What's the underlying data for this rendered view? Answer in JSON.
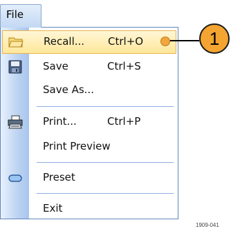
{
  "menubar": {
    "file_label": "File"
  },
  "menu": {
    "items": [
      {
        "label": "Recall...",
        "shortcut": "Ctrl+O",
        "icon": "folder-icon",
        "selected": true
      },
      {
        "label": "Save",
        "shortcut": "Ctrl+S",
        "icon": "floppy-disk-icon"
      },
      {
        "label": "Save As...",
        "shortcut": ""
      },
      {
        "label": "Print...",
        "shortcut": "Ctrl+P",
        "icon": "printer-icon"
      },
      {
        "label": "Print Preview",
        "shortcut": ""
      },
      {
        "label": "Preset",
        "shortcut": "",
        "icon": "preset-icon"
      },
      {
        "label": "Exit",
        "shortcut": ""
      }
    ]
  },
  "callout": {
    "number": "1",
    "color": "#f4a431"
  },
  "figure_id": "1909-041",
  "colors": {
    "highlight": "#ffe79a",
    "menu_border": "#5f86bd",
    "gutter": "#bcd3f1"
  }
}
